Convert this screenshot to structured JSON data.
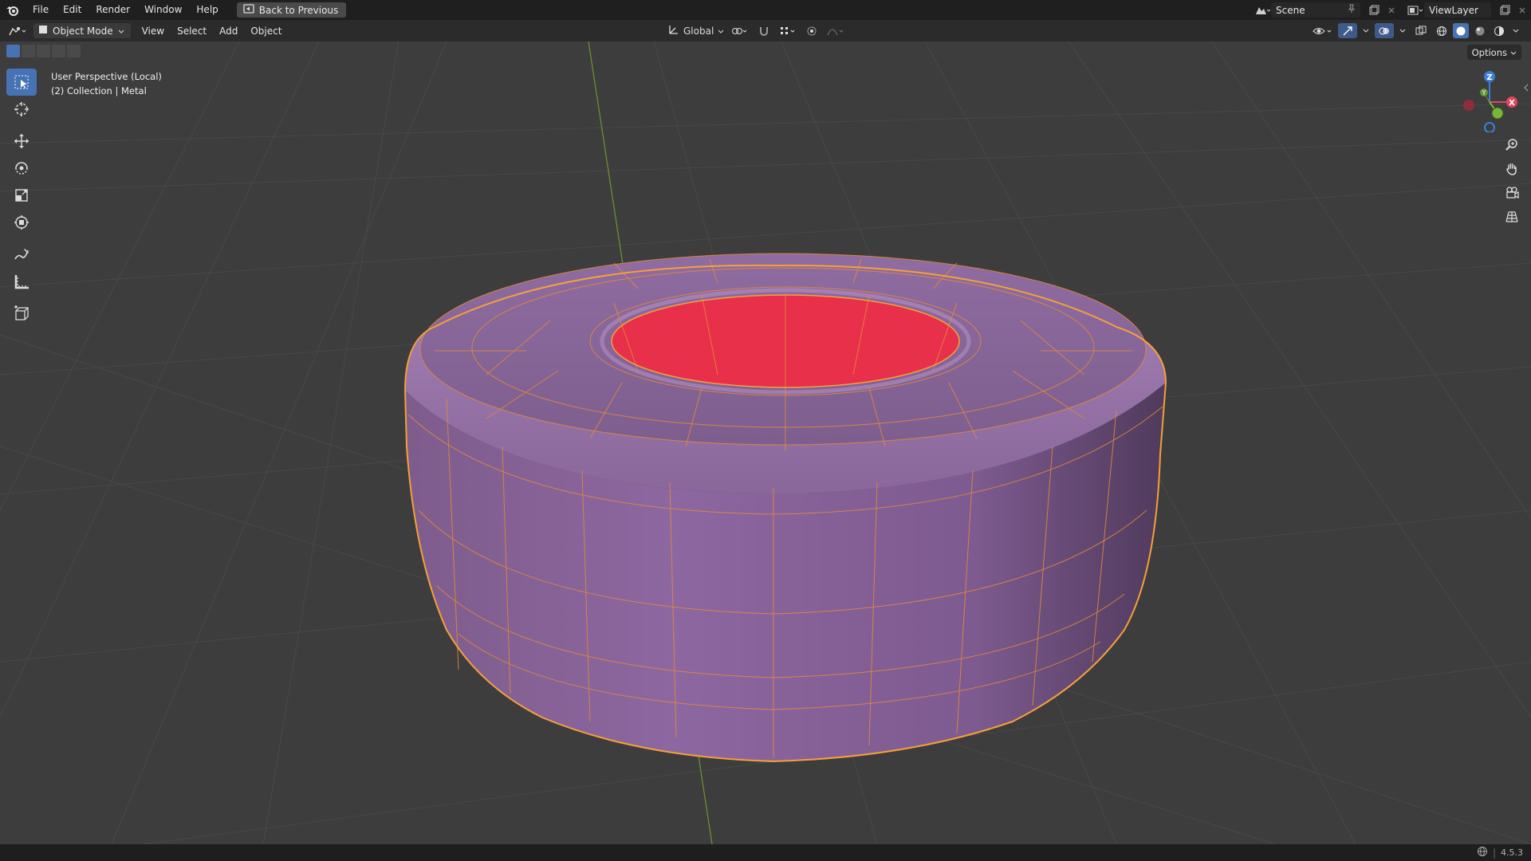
{
  "top_menu": {
    "items": [
      "File",
      "Edit",
      "Render",
      "Window",
      "Help"
    ],
    "back_label": "Back to Previous",
    "scene_name": "Scene",
    "view_layer": "ViewLayer"
  },
  "viewport_header": {
    "mode": "Object Mode",
    "menus": [
      "View",
      "Select",
      "Add",
      "Object"
    ],
    "transform_orientation": "Global"
  },
  "viewport": {
    "perspective": "User Perspective (Local)",
    "collection": "(2) Collection | Metal",
    "options_label": "Options",
    "axis_labels": {
      "x": "X",
      "y": "Y",
      "z": "Z"
    }
  },
  "status": {
    "version": "4.5.3"
  },
  "colors": {
    "accent": "#4772b3",
    "selection_outline": "#f5a03a",
    "object_surface": "#8b659b",
    "inner_face": "#e8304a",
    "grid_x_axis": "#9b3a3a",
    "grid_y_axis": "#6b8f2e"
  }
}
